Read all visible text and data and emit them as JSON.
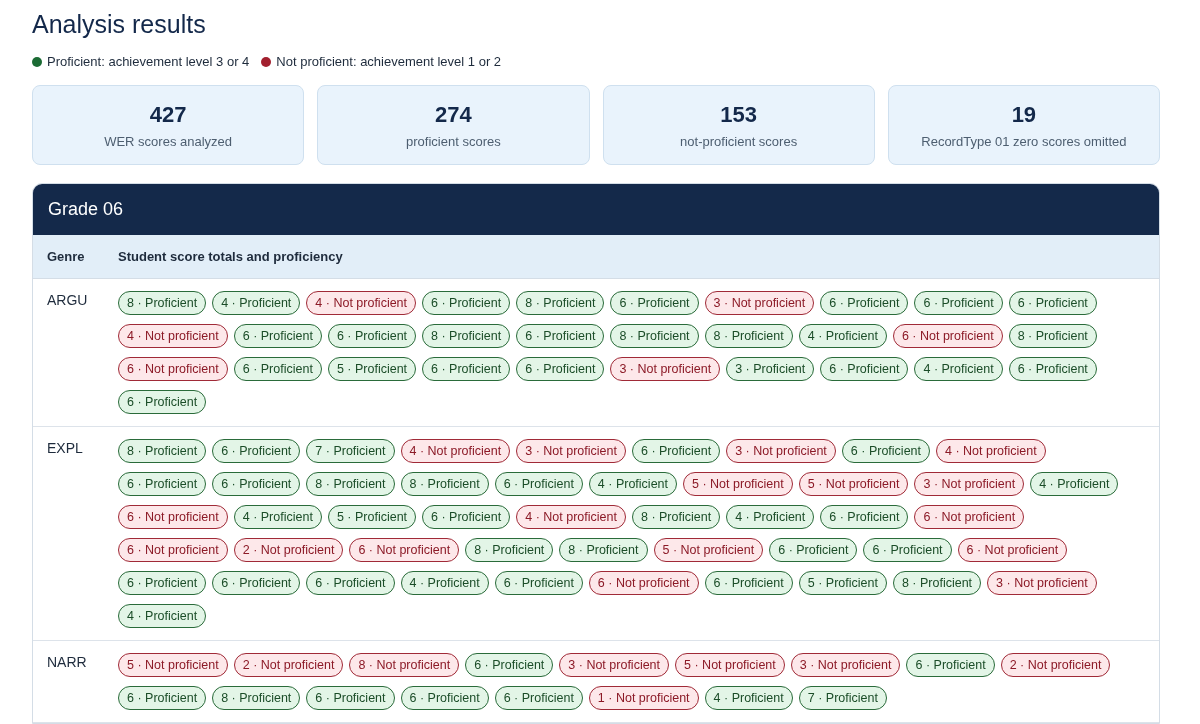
{
  "title": "Analysis results",
  "legend": [
    {
      "kind": "proficient",
      "label": "Proficient: achievement level 3 or 4"
    },
    {
      "kind": "not_proficient",
      "label": "Not proficient: achievement level 1 or 2"
    }
  ],
  "stats": [
    {
      "value": "427",
      "label": "WER scores analyzed"
    },
    {
      "value": "274",
      "label": "proficient scores"
    },
    {
      "value": "153",
      "label": "not-proficient scores"
    },
    {
      "value": "19",
      "label": "RecordType 01 zero scores omitted"
    }
  ],
  "grade": {
    "title": "Grade 06",
    "columns": [
      "Genre",
      "Student score totals and proficiency"
    ],
    "rows": [
      {
        "genre": "ARGU",
        "scores": [
          {
            "kind": "proficient",
            "text": "8 · Proficient"
          },
          {
            "kind": "proficient",
            "text": "4 · Proficient"
          },
          {
            "kind": "not_proficient",
            "text": "4 · Not proficient"
          },
          {
            "kind": "proficient",
            "text": "6 · Proficient"
          },
          {
            "kind": "proficient",
            "text": "8 · Proficient"
          },
          {
            "kind": "proficient",
            "text": "6 · Proficient"
          },
          {
            "kind": "not_proficient",
            "text": "3 · Not proficient"
          },
          {
            "kind": "proficient",
            "text": "6 · Proficient"
          },
          {
            "kind": "proficient",
            "text": "6 · Proficient"
          },
          {
            "kind": "proficient",
            "text": "6 · Proficient"
          },
          {
            "kind": "not_proficient",
            "text": "4 · Not proficient"
          },
          {
            "kind": "proficient",
            "text": "6 · Proficient"
          },
          {
            "kind": "proficient",
            "text": "6 · Proficient"
          },
          {
            "kind": "proficient",
            "text": "8 · Proficient"
          },
          {
            "kind": "proficient",
            "text": "6 · Proficient"
          },
          {
            "kind": "proficient",
            "text": "8 · Proficient"
          },
          {
            "kind": "proficient",
            "text": "8 · Proficient"
          },
          {
            "kind": "proficient",
            "text": "4 · Proficient"
          },
          {
            "kind": "not_proficient",
            "text": "6 · Not proficient"
          },
          {
            "kind": "proficient",
            "text": "8 · Proficient"
          },
          {
            "kind": "not_proficient",
            "text": "6 · Not proficient"
          },
          {
            "kind": "proficient",
            "text": "6 · Proficient"
          },
          {
            "kind": "proficient",
            "text": "5 · Proficient"
          },
          {
            "kind": "proficient",
            "text": "6 · Proficient"
          },
          {
            "kind": "proficient",
            "text": "6 · Proficient"
          },
          {
            "kind": "not_proficient",
            "text": "3 · Not proficient"
          },
          {
            "kind": "proficient",
            "text": "3 · Proficient"
          },
          {
            "kind": "proficient",
            "text": "6 · Proficient"
          },
          {
            "kind": "proficient",
            "text": "4 · Proficient"
          },
          {
            "kind": "proficient",
            "text": "6 · Proficient"
          },
          {
            "kind": "proficient",
            "text": "6 · Proficient"
          }
        ]
      },
      {
        "genre": "EXPL",
        "scores": [
          {
            "kind": "proficient",
            "text": "8 · Proficient"
          },
          {
            "kind": "proficient",
            "text": "6 · Proficient"
          },
          {
            "kind": "proficient",
            "text": "7 · Proficient"
          },
          {
            "kind": "not_proficient",
            "text": "4 · Not proficient"
          },
          {
            "kind": "not_proficient",
            "text": "3 · Not proficient"
          },
          {
            "kind": "proficient",
            "text": "6 · Proficient"
          },
          {
            "kind": "not_proficient",
            "text": "3 · Not proficient"
          },
          {
            "kind": "proficient",
            "text": "6 · Proficient"
          },
          {
            "kind": "not_proficient",
            "text": "4 · Not proficient"
          },
          {
            "kind": "proficient",
            "text": "6 · Proficient"
          },
          {
            "kind": "proficient",
            "text": "6 · Proficient"
          },
          {
            "kind": "proficient",
            "text": "8 · Proficient"
          },
          {
            "kind": "proficient",
            "text": "8 · Proficient"
          },
          {
            "kind": "proficient",
            "text": "6 · Proficient"
          },
          {
            "kind": "proficient",
            "text": "4 · Proficient"
          },
          {
            "kind": "not_proficient",
            "text": "5 · Not proficient"
          },
          {
            "kind": "not_proficient",
            "text": "5 · Not proficient"
          },
          {
            "kind": "not_proficient",
            "text": "3 · Not proficient"
          },
          {
            "kind": "proficient",
            "text": "4 · Proficient"
          },
          {
            "kind": "not_proficient",
            "text": "6 · Not proficient"
          },
          {
            "kind": "proficient",
            "text": "4 · Proficient"
          },
          {
            "kind": "proficient",
            "text": "5 · Proficient"
          },
          {
            "kind": "proficient",
            "text": "6 · Proficient"
          },
          {
            "kind": "not_proficient",
            "text": "4 · Not proficient"
          },
          {
            "kind": "proficient",
            "text": "8 · Proficient"
          },
          {
            "kind": "proficient",
            "text": "4 · Proficient"
          },
          {
            "kind": "proficient",
            "text": "6 · Proficient"
          },
          {
            "kind": "not_proficient",
            "text": "6 · Not proficient"
          },
          {
            "kind": "not_proficient",
            "text": "6 · Not proficient"
          },
          {
            "kind": "not_proficient",
            "text": "2 · Not proficient"
          },
          {
            "kind": "not_proficient",
            "text": "6 · Not proficient"
          },
          {
            "kind": "proficient",
            "text": "8 · Proficient"
          },
          {
            "kind": "proficient",
            "text": "8 · Proficient"
          },
          {
            "kind": "not_proficient",
            "text": "5 · Not proficient"
          },
          {
            "kind": "proficient",
            "text": "6 · Proficient"
          },
          {
            "kind": "proficient",
            "text": "6 · Proficient"
          },
          {
            "kind": "not_proficient",
            "text": "6 · Not proficient"
          },
          {
            "kind": "proficient",
            "text": "6 · Proficient"
          },
          {
            "kind": "proficient",
            "text": "6 · Proficient"
          },
          {
            "kind": "proficient",
            "text": "6 · Proficient"
          },
          {
            "kind": "proficient",
            "text": "4 · Proficient"
          },
          {
            "kind": "proficient",
            "text": "6 · Proficient"
          },
          {
            "kind": "not_proficient",
            "text": "6 · Not proficient"
          },
          {
            "kind": "proficient",
            "text": "6 · Proficient"
          },
          {
            "kind": "proficient",
            "text": "5 · Proficient"
          },
          {
            "kind": "proficient",
            "text": "8 · Proficient"
          },
          {
            "kind": "not_proficient",
            "text": "3 · Not proficient"
          },
          {
            "kind": "proficient",
            "text": "4 · Proficient"
          }
        ]
      },
      {
        "genre": "NARR",
        "scores": [
          {
            "kind": "not_proficient",
            "text": "5 · Not proficient"
          },
          {
            "kind": "not_proficient",
            "text": "2 · Not proficient"
          },
          {
            "kind": "not_proficient",
            "text": "8 · Not proficient"
          },
          {
            "kind": "proficient",
            "text": "6 · Proficient"
          },
          {
            "kind": "not_proficient",
            "text": "3 · Not proficient"
          },
          {
            "kind": "not_proficient",
            "text": "5 · Not proficient"
          },
          {
            "kind": "not_proficient",
            "text": "3 · Not proficient"
          },
          {
            "kind": "proficient",
            "text": "6 · Proficient"
          },
          {
            "kind": "not_proficient",
            "text": "2 · Not proficient"
          },
          {
            "kind": "proficient",
            "text": "6 · Proficient"
          },
          {
            "kind": "proficient",
            "text": "8 · Proficient"
          },
          {
            "kind": "proficient",
            "text": "6 · Proficient"
          },
          {
            "kind": "proficient",
            "text": "6 · Proficient"
          },
          {
            "kind": "proficient",
            "text": "6 · Proficient"
          },
          {
            "kind": "not_proficient",
            "text": "1 · Not proficient"
          },
          {
            "kind": "proficient",
            "text": "4 · Proficient"
          },
          {
            "kind": "proficient",
            "text": "7 · Proficient"
          }
        ]
      }
    ]
  }
}
